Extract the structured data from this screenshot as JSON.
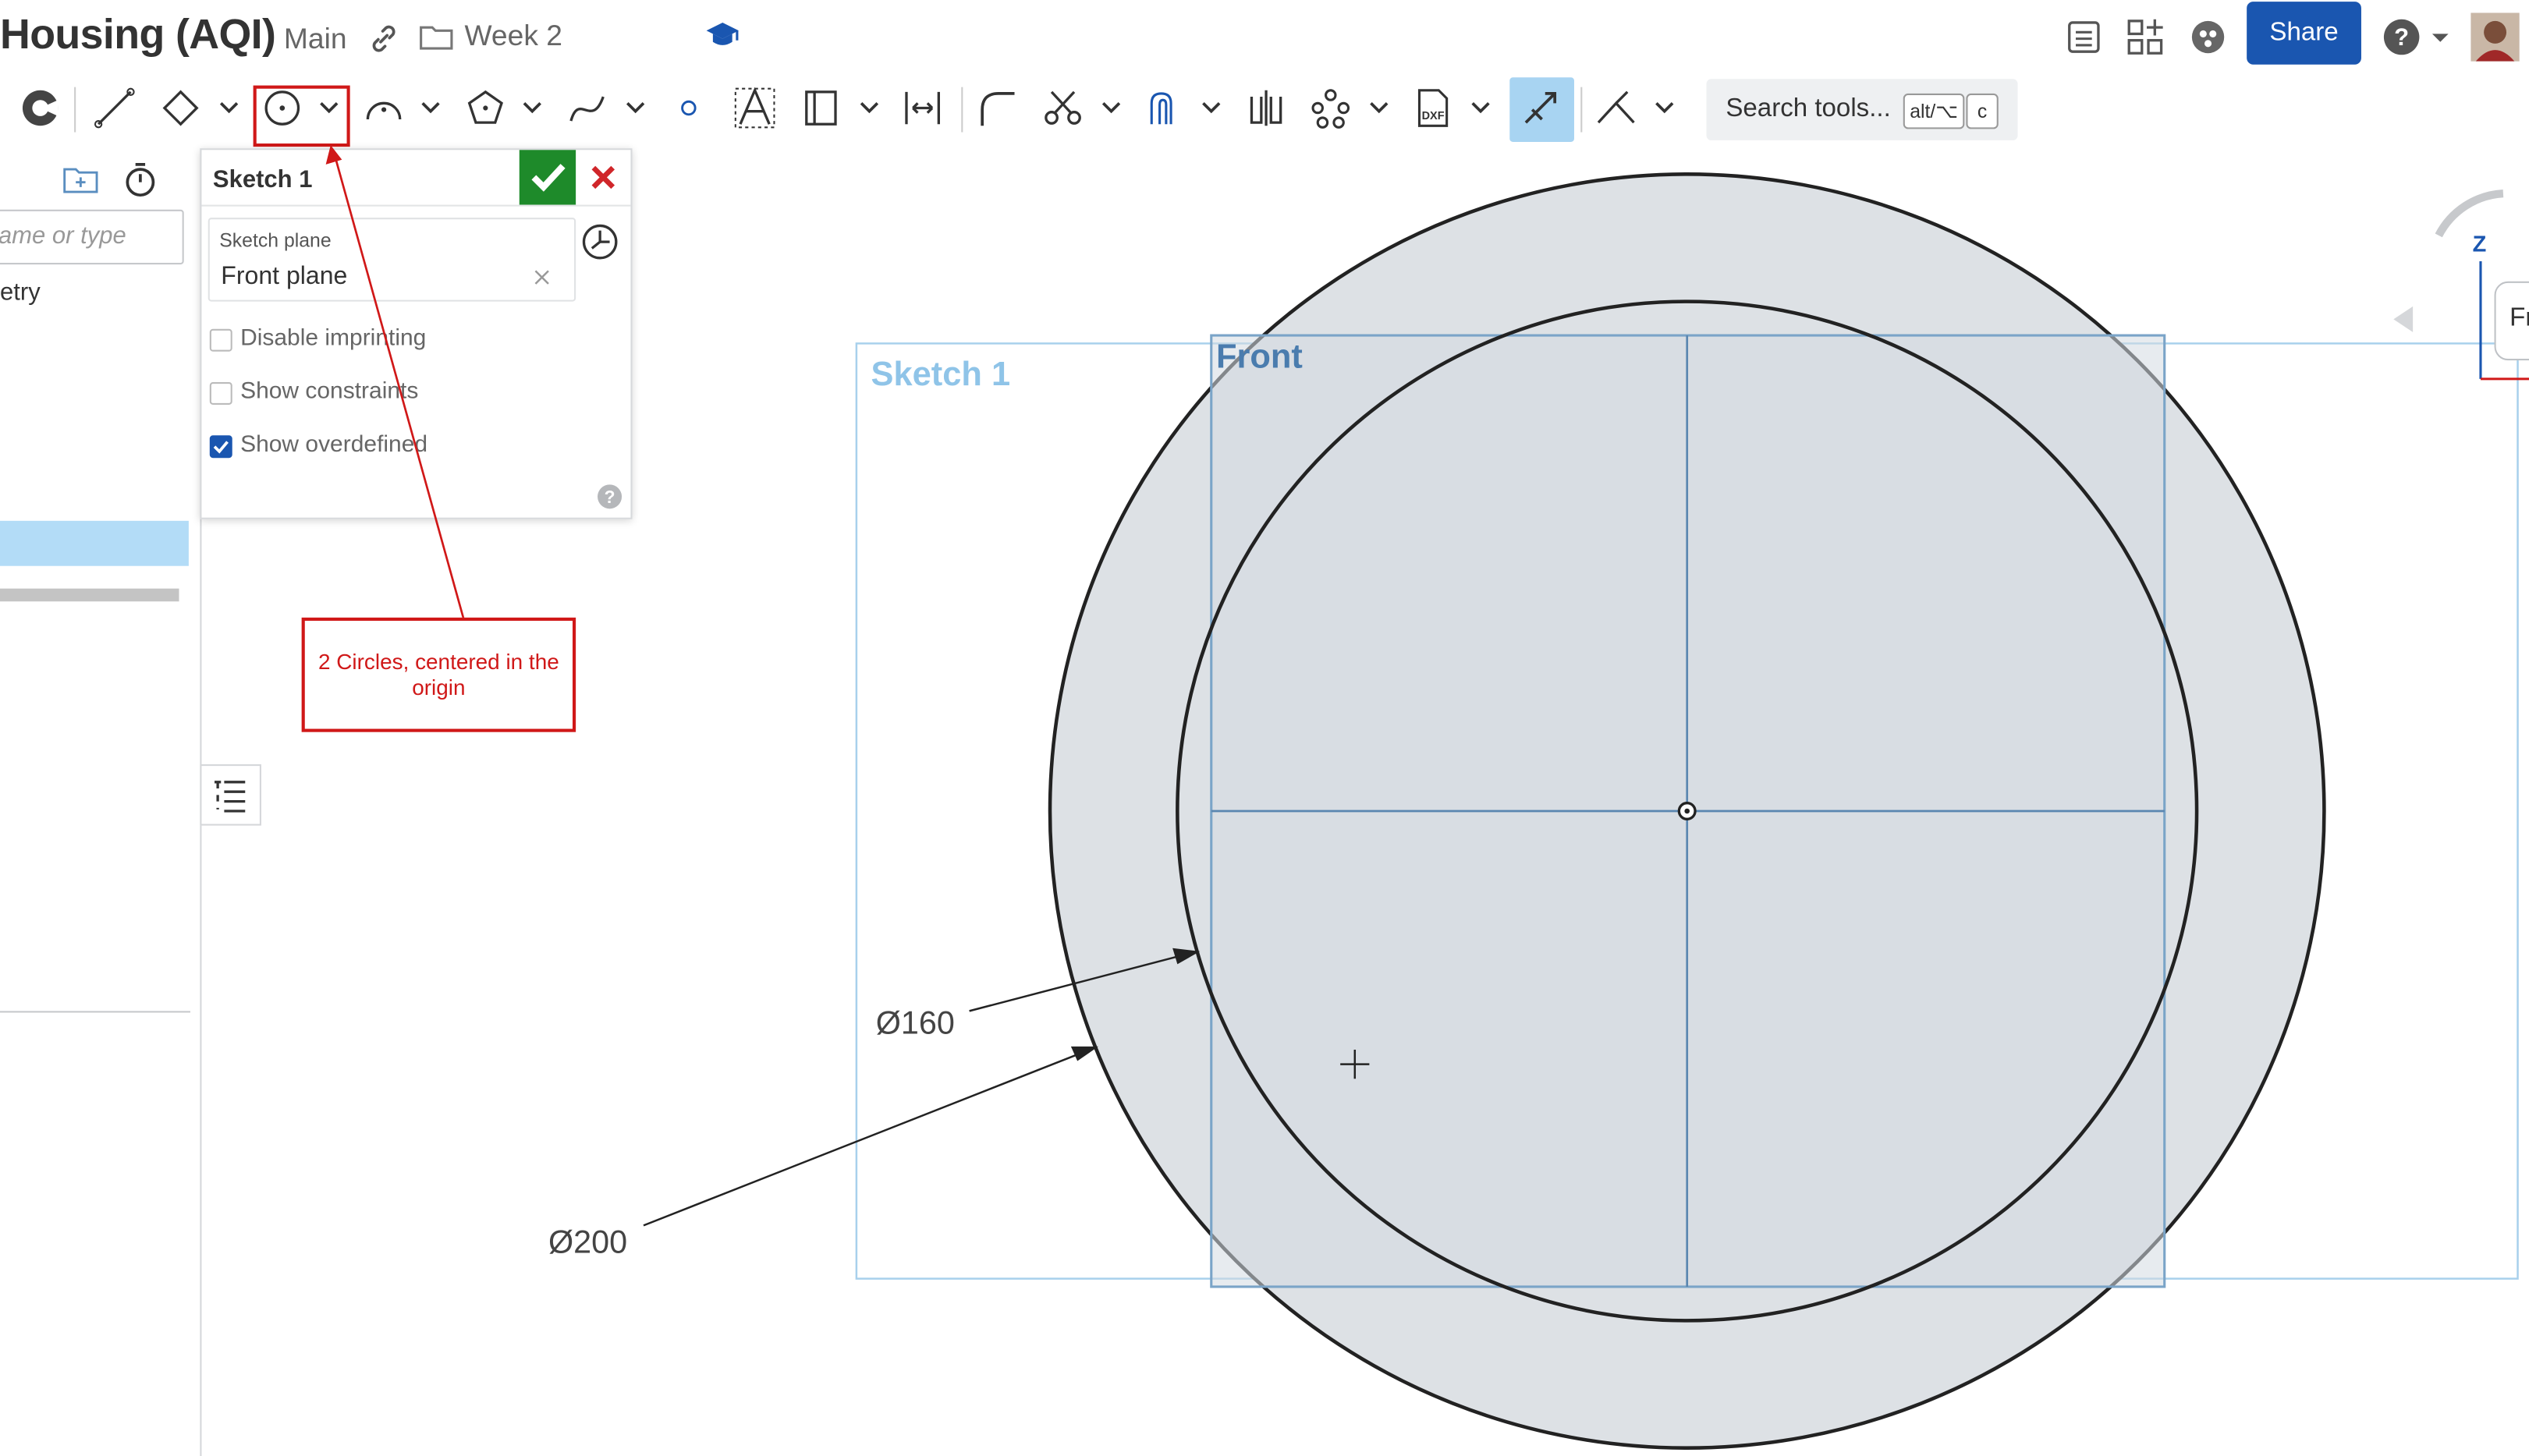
{
  "header": {
    "doc_title": "Housing (AQI)",
    "branch": "Main",
    "folder": "Week 2",
    "share_label": "Share"
  },
  "toolbar": {
    "search_label": "Search tools...",
    "shortcut_1": "alt/⌥",
    "shortcut_2": "c"
  },
  "left_panel": {
    "filter_placeholder": "ame or type",
    "item_partial": "etry"
  },
  "sketch_panel": {
    "title": "Sketch 1",
    "plane_label": "Sketch plane",
    "plane_value": "Front plane",
    "options": [
      {
        "label": "Disable imprinting",
        "checked": false
      },
      {
        "label": "Show constraints",
        "checked": false
      },
      {
        "label": "Show overdefined",
        "checked": true
      }
    ]
  },
  "annotation": {
    "line1": "2 Circles, centered in the",
    "line2": "origin"
  },
  "canvas": {
    "sketch_label": "Sketch 1",
    "plane_label": "Front",
    "dim_inner": "Ø160",
    "dim_outer": "Ø200",
    "axis_z": "Z",
    "view_cube_partial": "Fr"
  },
  "colors": {
    "brand_blue": "#1a56b0",
    "accept_green": "#1e8a2a",
    "cancel_red": "#d0262a",
    "annotation_red": "#d01818",
    "sketch_fill": "#dde1e5",
    "plane_blue": "#8fb8dc"
  }
}
